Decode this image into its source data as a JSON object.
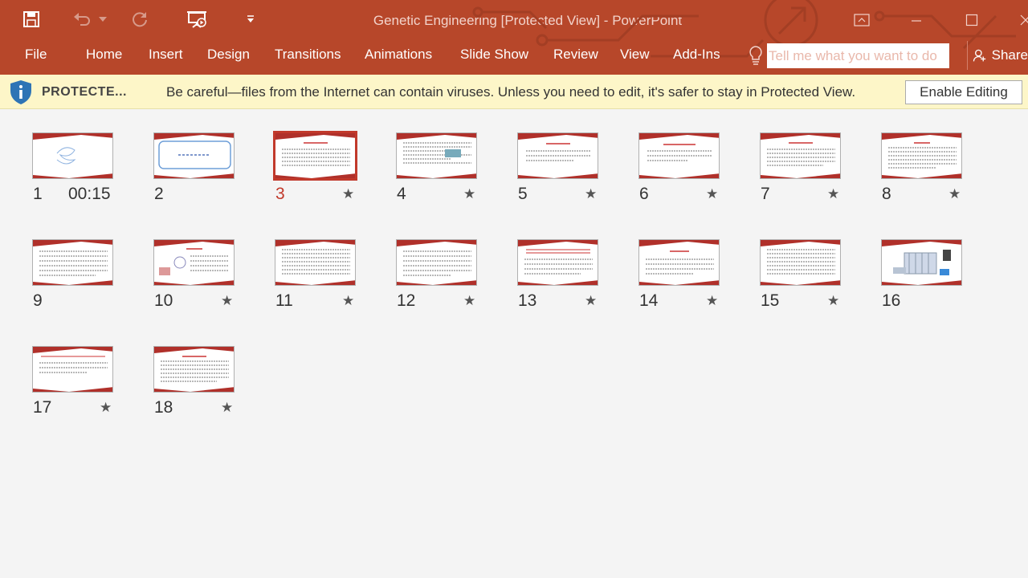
{
  "window": {
    "title": "Genetic Engineering [Protected View] - PowerPoint"
  },
  "qat": {
    "icons": [
      "save-icon",
      "undo-icon",
      "redo-icon",
      "present-from-beginning-icon",
      "customize-qat-icon"
    ]
  },
  "ribbon": {
    "tabs": [
      {
        "label": "File"
      },
      {
        "label": "Home"
      },
      {
        "label": "Insert"
      },
      {
        "label": "Design"
      },
      {
        "label": "Transitions"
      },
      {
        "label": "Animations"
      },
      {
        "label": "Slide Show"
      },
      {
        "label": "Review"
      },
      {
        "label": "View"
      },
      {
        "label": "Add-Ins"
      }
    ],
    "tell_me_placeholder": "Tell me what you want to do",
    "share_label": "Share"
  },
  "message_bar": {
    "label": "PROTECTE...",
    "text": "Be careful—files from the Internet can contain viruses. Unless you need to edit, it's safer to stay in Protected View.",
    "button": "Enable Editing"
  },
  "slides": [
    {
      "number": "1",
      "timing": "00:15",
      "has_animation": false,
      "selected": false
    },
    {
      "number": "2",
      "timing": "",
      "has_animation": false,
      "selected": false
    },
    {
      "number": "3",
      "timing": "",
      "has_animation": true,
      "selected": true
    },
    {
      "number": "4",
      "timing": "",
      "has_animation": true,
      "selected": false
    },
    {
      "number": "5",
      "timing": "",
      "has_animation": true,
      "selected": false
    },
    {
      "number": "6",
      "timing": "",
      "has_animation": true,
      "selected": false
    },
    {
      "number": "7",
      "timing": "",
      "has_animation": true,
      "selected": false
    },
    {
      "number": "8",
      "timing": "",
      "has_animation": true,
      "selected": false
    },
    {
      "number": "9",
      "timing": "",
      "has_animation": false,
      "selected": false
    },
    {
      "number": "10",
      "timing": "",
      "has_animation": true,
      "selected": false
    },
    {
      "number": "11",
      "timing": "",
      "has_animation": true,
      "selected": false
    },
    {
      "number": "12",
      "timing": "",
      "has_animation": true,
      "selected": false
    },
    {
      "number": "13",
      "timing": "",
      "has_animation": true,
      "selected": false
    },
    {
      "number": "14",
      "timing": "",
      "has_animation": true,
      "selected": false
    },
    {
      "number": "15",
      "timing": "",
      "has_animation": true,
      "selected": false
    },
    {
      "number": "16",
      "timing": "",
      "has_animation": false,
      "selected": false
    },
    {
      "number": "17",
      "timing": "",
      "has_animation": true,
      "selected": false
    },
    {
      "number": "18",
      "timing": "",
      "has_animation": true,
      "selected": false
    }
  ],
  "colors": {
    "accent": "#b7472a",
    "message_bar": "#fdf6c8",
    "selection": "#c1392b"
  }
}
